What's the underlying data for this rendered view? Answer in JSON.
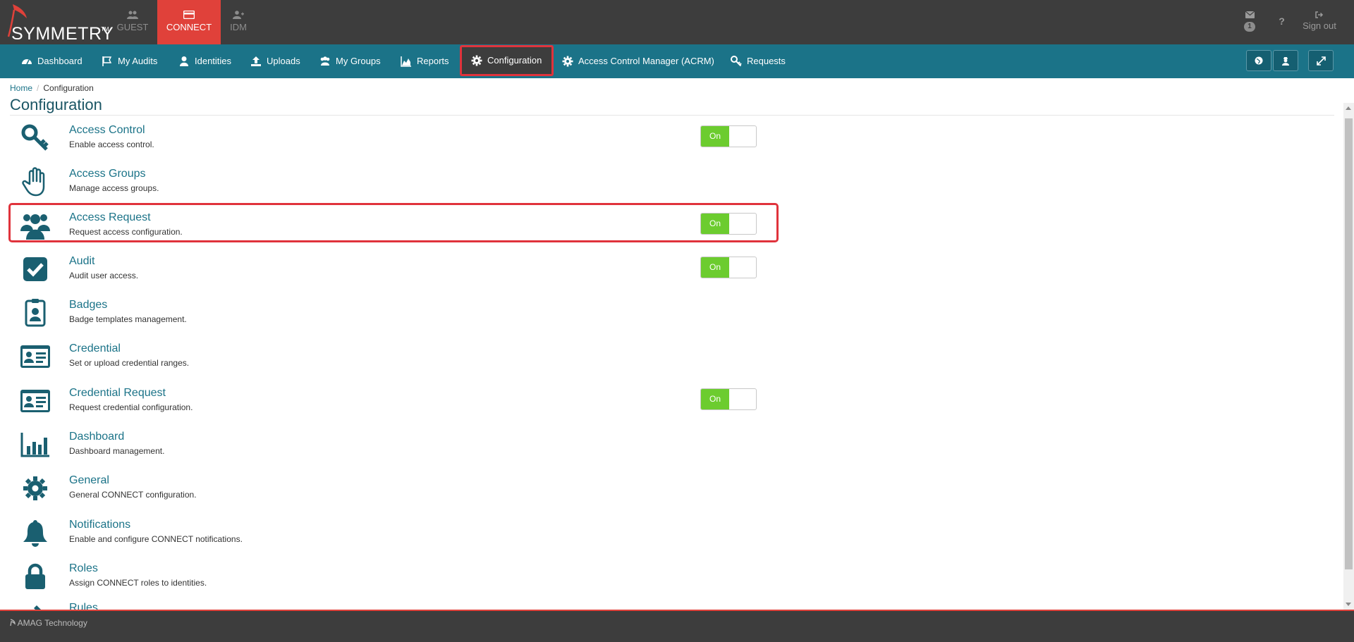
{
  "brand": {
    "name": "SYMMETRY",
    "tm": "TM"
  },
  "app_tabs": [
    {
      "label": "GUEST",
      "icon": "users-icon"
    },
    {
      "label": "CONNECT",
      "icon": "card-icon",
      "active": true
    },
    {
      "label": "IDM",
      "icon": "user-plus-icon"
    }
  ],
  "top_right": {
    "mail_count": "1",
    "help": "?",
    "sign_out": "Sign out"
  },
  "nav": [
    {
      "label": "Dashboard",
      "icon": "dashboard-icon"
    },
    {
      "label": "My Audits",
      "icon": "flag-icon"
    },
    {
      "label": "Identities",
      "icon": "user-icon"
    },
    {
      "label": "Uploads",
      "icon": "upload-icon"
    },
    {
      "label": "My Groups",
      "icon": "users-icon"
    },
    {
      "label": "Reports",
      "icon": "area-chart-icon"
    },
    {
      "label": "Configuration",
      "icon": "gear-icon",
      "active": true
    },
    {
      "label": "Access Control Manager (ACRM)",
      "icon": "gear-icon"
    },
    {
      "label": "Requests",
      "icon": "key-icon"
    }
  ],
  "breadcrumb": {
    "home": "Home",
    "current": "Configuration"
  },
  "page_title": "Configuration",
  "config_items": [
    {
      "title": "Access Control",
      "desc": "Enable access control.",
      "icon": "key-icon",
      "toggle": "On"
    },
    {
      "title": "Access Groups",
      "desc": "Manage access groups.",
      "icon": "hand-icon",
      "toggle": null
    },
    {
      "title": "Access Request",
      "desc": "Request access configuration.",
      "icon": "users-icon",
      "toggle": "On"
    },
    {
      "title": "Audit",
      "desc": "Audit user access.",
      "icon": "check-square-icon",
      "toggle": "On"
    },
    {
      "title": "Badges",
      "desc": "Badge templates management.",
      "icon": "badge-icon",
      "toggle": null
    },
    {
      "title": "Credential",
      "desc": "Set or upload credential ranges.",
      "icon": "id-card-icon",
      "toggle": null
    },
    {
      "title": "Credential Request",
      "desc": "Request credential configuration.",
      "icon": "id-card-icon",
      "toggle": "On"
    },
    {
      "title": "Dashboard",
      "desc": "Dashboard management.",
      "icon": "bar-chart-icon",
      "toggle": null
    },
    {
      "title": "General",
      "desc": "General CONNECT configuration.",
      "icon": "gear-icon",
      "toggle": null
    },
    {
      "title": "Notifications",
      "desc": "Enable and configure CONNECT notifications.",
      "icon": "bell-icon",
      "toggle": null
    },
    {
      "title": "Roles",
      "desc": "Assign CONNECT roles to identities.",
      "icon": "lock-icon",
      "toggle": null
    },
    {
      "title": "Rules",
      "desc": "",
      "icon": "gavel-icon",
      "toggle": null
    }
  ],
  "footer": {
    "text": "AMAG Technology"
  },
  "colors": {
    "topbar": "#3d3d3d",
    "navbar": "#1b7388",
    "accent": "#e0413a",
    "toggle_on": "#6ccc2f",
    "link": "#1b7388"
  }
}
